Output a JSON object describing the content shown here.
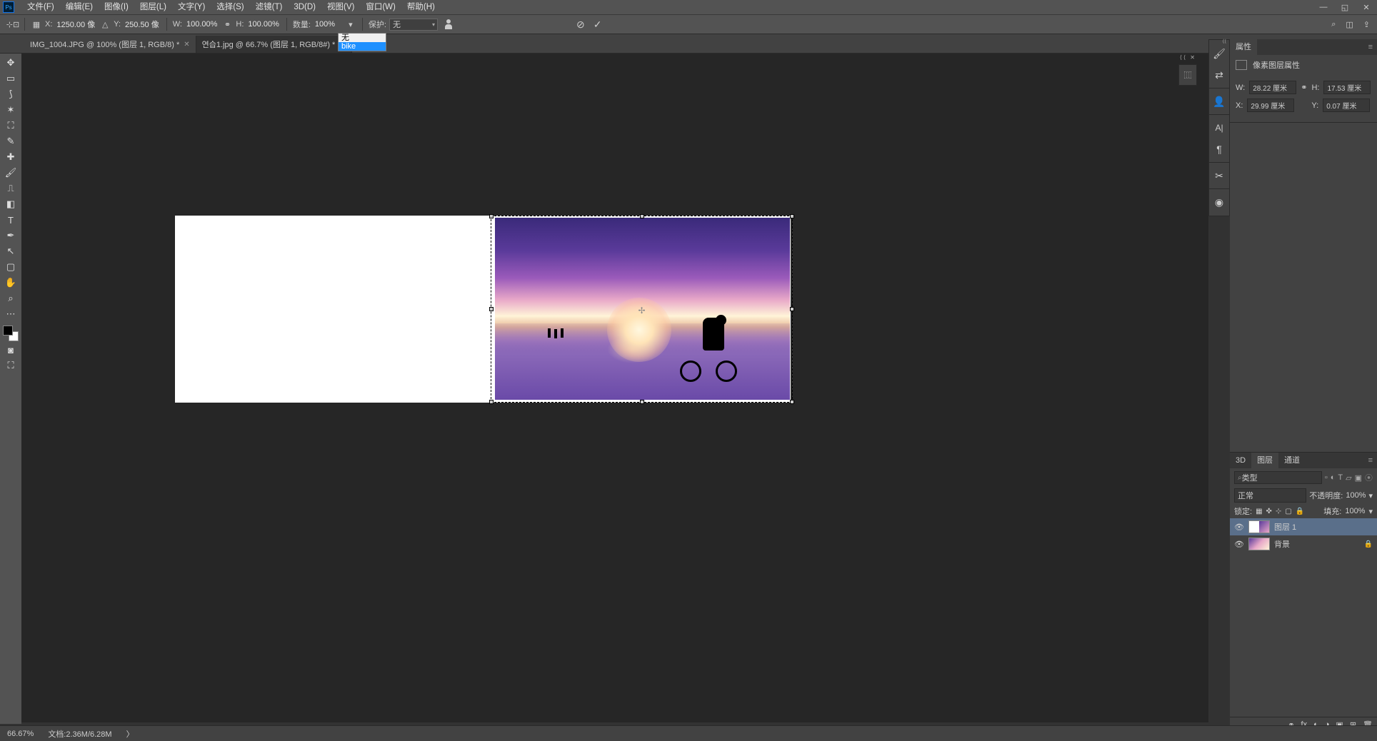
{
  "menu": {
    "items": [
      "文件(F)",
      "编辑(E)",
      "图像(I)",
      "图层(L)",
      "文字(Y)",
      "选择(S)",
      "滤镜(T)",
      "3D(D)",
      "视图(V)",
      "窗口(W)",
      "帮助(H)"
    ]
  },
  "options": {
    "x_label": "X:",
    "x": "1250.00 像",
    "y_label": "Y:",
    "y": "250.50 像",
    "w_label": "W:",
    "w": "100.00%",
    "h_label": "H:",
    "h": "100.00%",
    "qty_label": "数量:",
    "qty": "100%",
    "protect_label": "保护:",
    "protect": "无",
    "dropdown": {
      "opt1": "无",
      "opt2": "bike"
    }
  },
  "tabs": {
    "t1": "IMG_1004.JPG @ 100% (图层 1, RGB/8) *",
    "t2": "연습1.jpg @ 66.7% (图层 1, RGB/8#) *"
  },
  "properties": {
    "title": "属性",
    "doc": "像素图层属性",
    "w_label": "W:",
    "w": "28.22 厘米",
    "h_label": "H:",
    "h": "17.53 厘米",
    "x_label": "X:",
    "x": "29.99 厘米",
    "y_label": "Y:",
    "y": "0.07 厘米"
  },
  "layers": {
    "tabs": {
      "t3d": "3D",
      "layers": "图层",
      "channels": "通道"
    },
    "kind": "类型",
    "blend": "正常",
    "opacity_label": "不透明度:",
    "opacity": "100%",
    "lock_label": "锁定:",
    "fill_label": "填充:",
    "fill": "100%",
    "l1": "图层 1",
    "l2": "背景"
  },
  "status": {
    "zoom": "66.67%",
    "doc": "文档:2.36M/6.28M"
  }
}
